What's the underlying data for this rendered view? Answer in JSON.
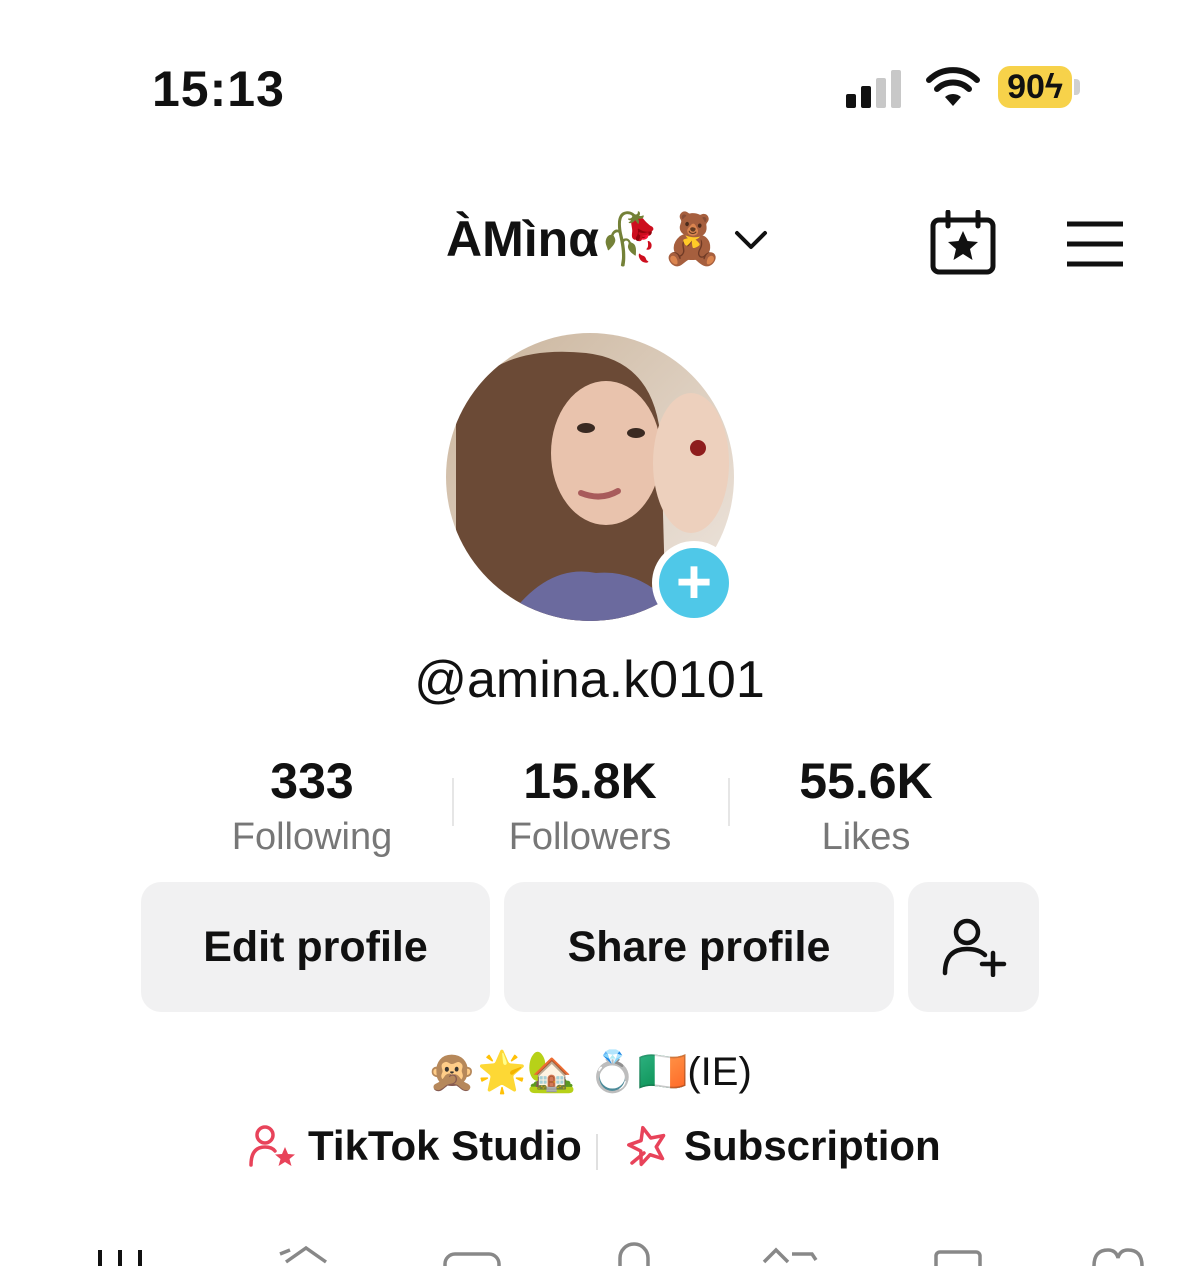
{
  "status_bar": {
    "time": "15:13",
    "battery": "90"
  },
  "header": {
    "display_name": "ÀMìnα🥀🧸"
  },
  "profile": {
    "handle": "@amina.k0101"
  },
  "stats": [
    {
      "value": "333",
      "label": "Following"
    },
    {
      "value": "15.8K",
      "label": "Followers"
    },
    {
      "value": "55.6K",
      "label": "Likes"
    }
  ],
  "actions": {
    "edit_label": "Edit profile",
    "share_label": "Share profile"
  },
  "bio": "🙊🌟🏡 💍🇮🇪(IE)",
  "links": {
    "studio_label": "TikTok Studio",
    "subscription_label": "Subscription"
  },
  "colors": {
    "accent": "#4fc8e8",
    "battery": "#f7d24a",
    "link_icon": "#e8435a",
    "button_bg": "#f1f1f2"
  }
}
